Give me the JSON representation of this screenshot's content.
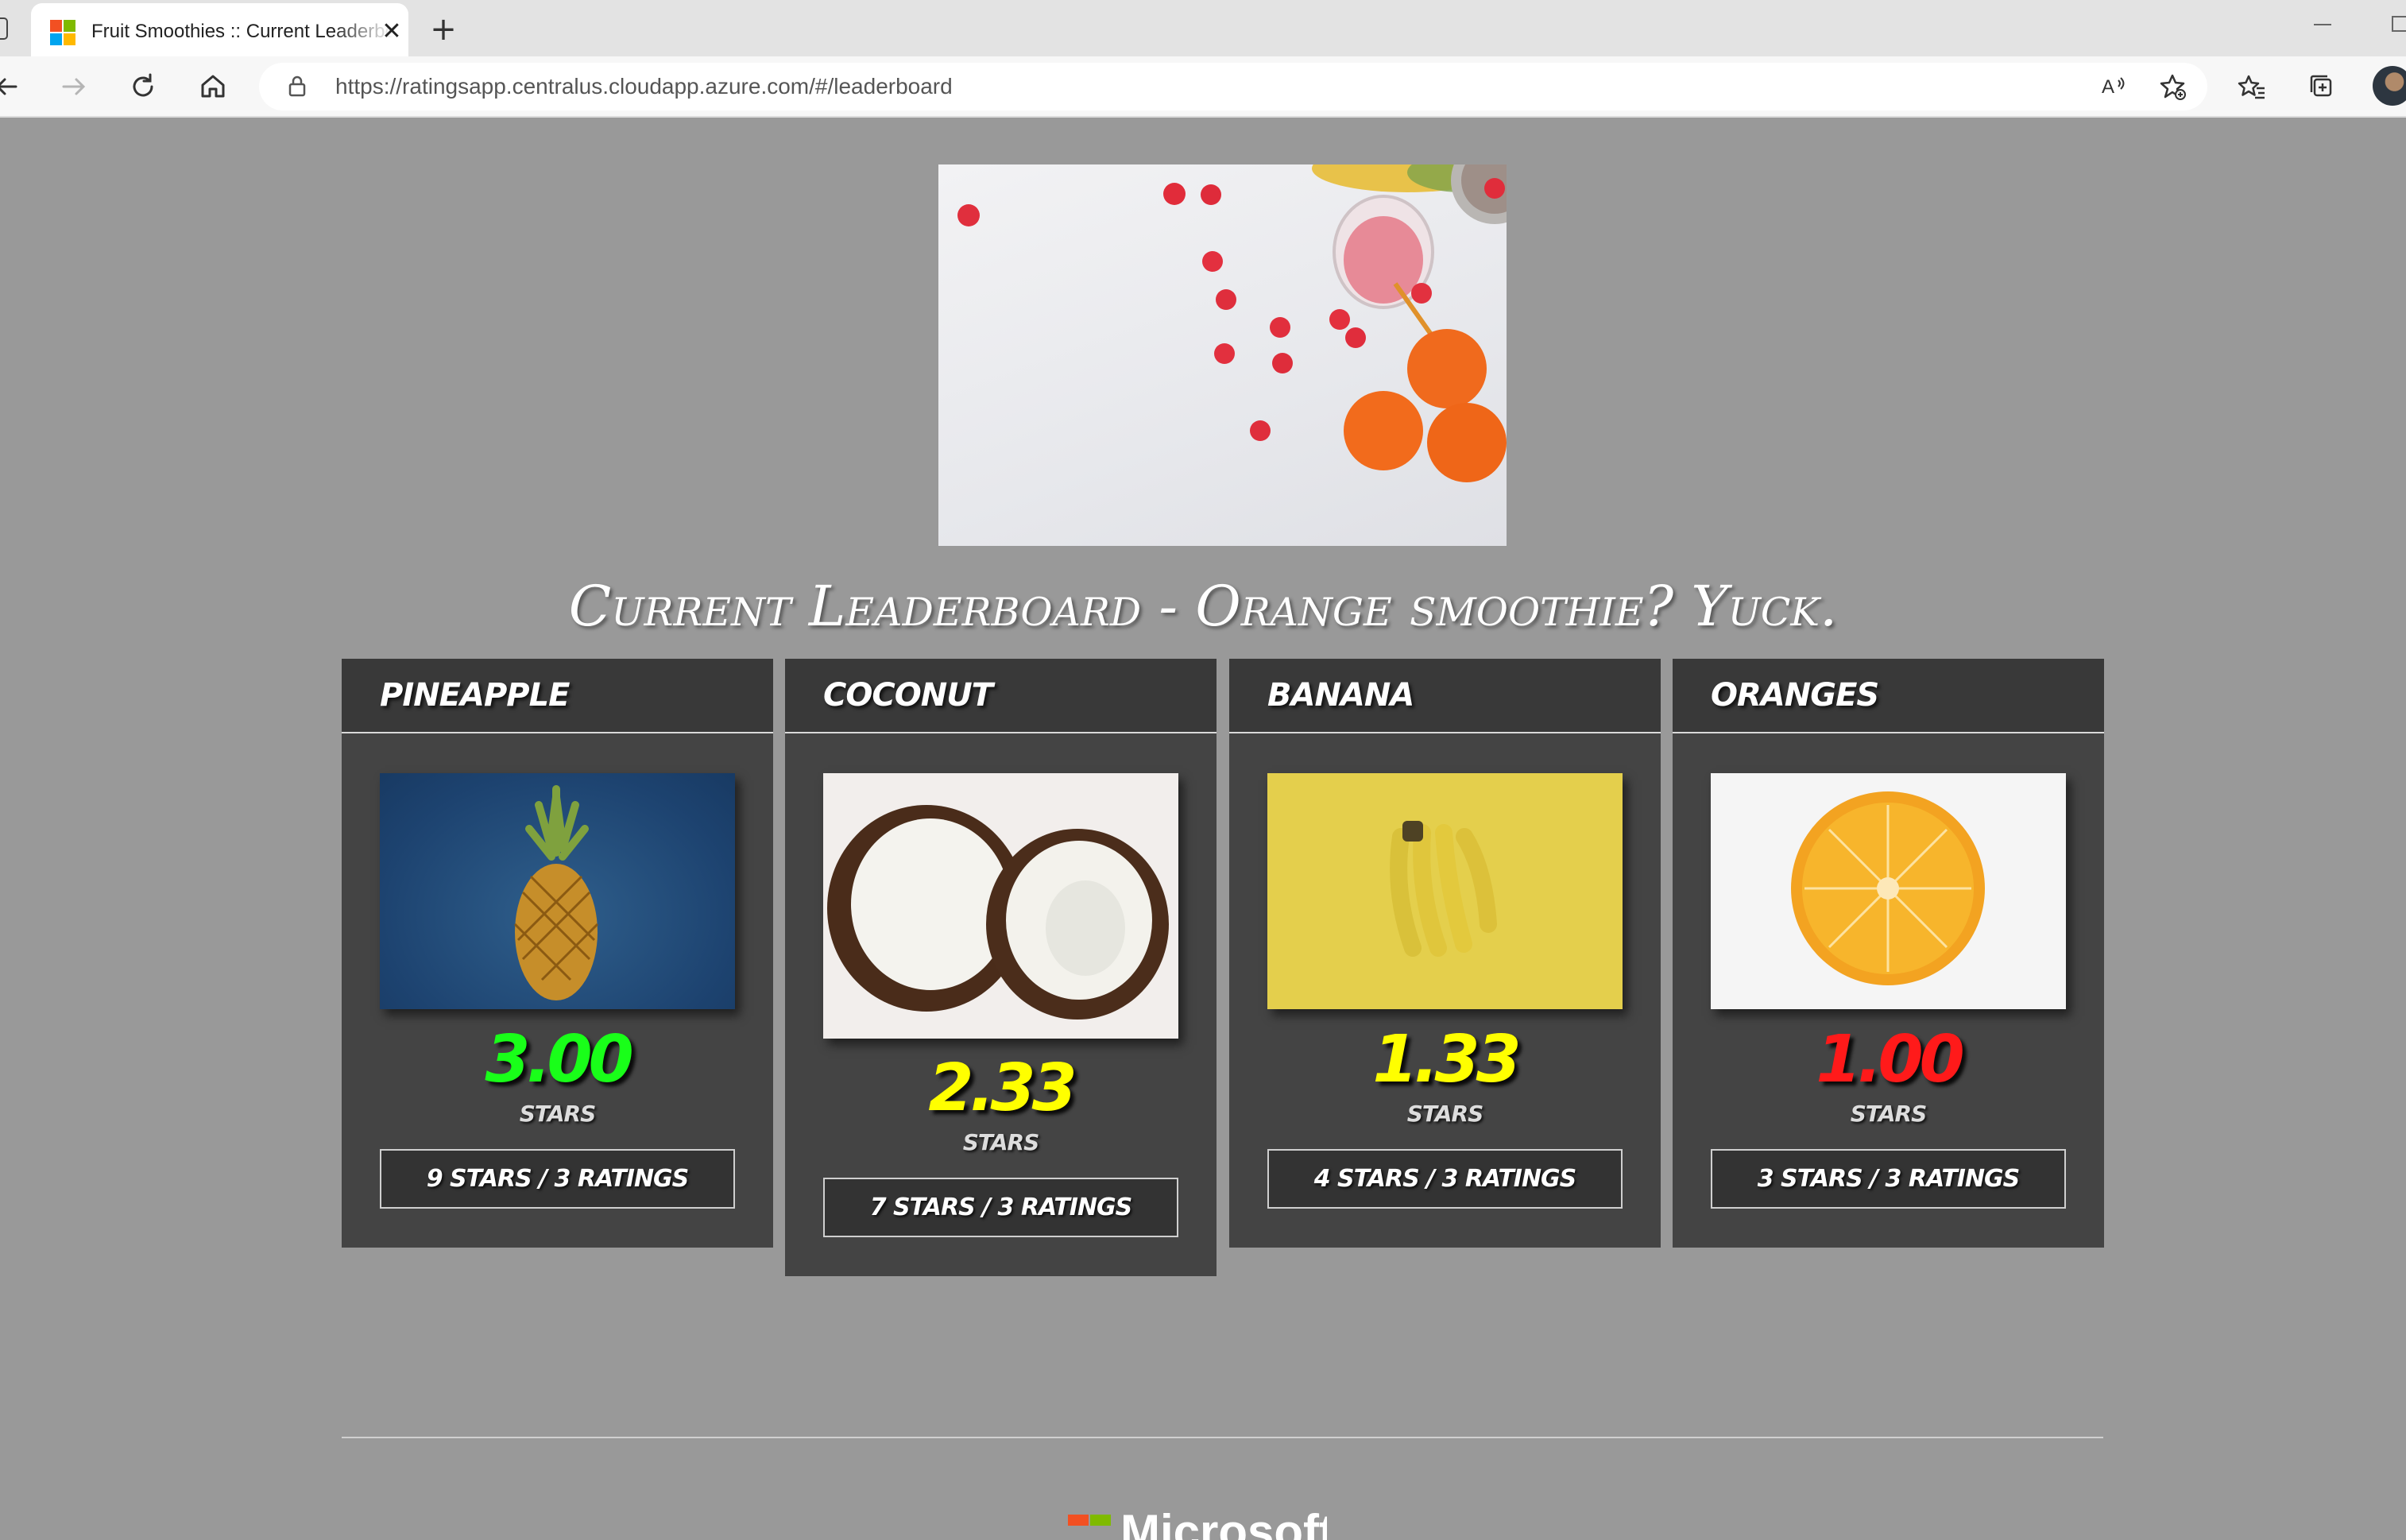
{
  "browser": {
    "tab_title": "Fruit Smoothies :: Current Leaderboard",
    "close_glyph": "✕",
    "new_tab_glyph": "+",
    "url_host": "https://ratingsapp.centralus.cloudapp.azure.com",
    "url_path": "/#/leaderboard",
    "icons": [
      "back-icon",
      "forward-icon",
      "refresh-icon",
      "home-icon",
      "lock-icon",
      "read-aloud-icon",
      "add-favorite-icon",
      "favorites-icon",
      "collections-icon",
      "profile-avatar"
    ]
  },
  "page": {
    "heading": "Current Leaderboard - Orange smoothie? Yuck.",
    "hero_alt": "Smoothie with raspberries and oranges"
  },
  "leaderboard": [
    {
      "name": "Pineapple",
      "score": "3.00",
      "stars_label": "Stars",
      "tally": "9 Stars / 3 Ratings",
      "score_color": "#19ff19"
    },
    {
      "name": "Coconut",
      "score": "2.33",
      "stars_label": "Stars",
      "tally": "7 Stars / 3 Ratings",
      "score_color": "#ffff00"
    },
    {
      "name": "Banana",
      "score": "1.33",
      "stars_label": "Stars",
      "tally": "4 Stars / 3 Ratings",
      "score_color": "#ffff00"
    },
    {
      "name": "Oranges",
      "score": "1.00",
      "stars_label": "Stars",
      "tally": "3 Stars / 3 Ratings",
      "score_color": "#ff1a1a"
    }
  ],
  "footer": {
    "brand": "Microsoft",
    "brand_colors": [
      "#f25022",
      "#7fba00",
      "#00a4ef",
      "#ffb900"
    ]
  }
}
